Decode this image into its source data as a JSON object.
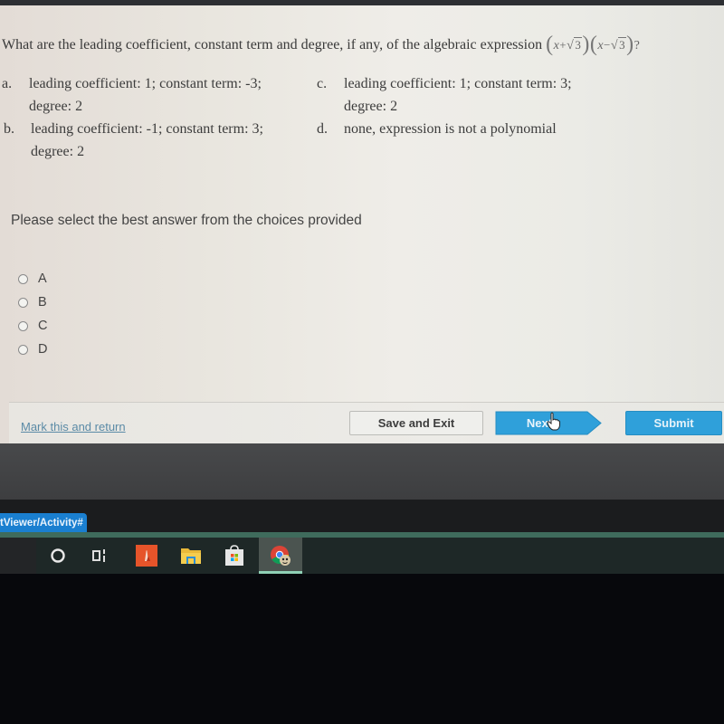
{
  "question": {
    "text": "What are the leading coefficient, constant term and degree, if any, of the algebraic expression",
    "expression": {
      "factor1": {
        "var": "x",
        "op": "+",
        "radicand": "3"
      },
      "factor2": {
        "var": "x",
        "op": "−",
        "radicand": "3"
      },
      "suffix": "?"
    }
  },
  "choices": [
    {
      "letter": "a.",
      "text": "leading coefficient: 1; constant term: -3; degree: 2"
    },
    {
      "letter": "b.",
      "text": "leading coefficient: -1; constant term: 3; degree: 2"
    },
    {
      "letter": "c.",
      "text": "leading coefficient: 1; constant term: 3; degree: 2"
    },
    {
      "letter": "d.",
      "text": "none, expression is not a polynomial"
    }
  ],
  "prompt": "Please select the best answer from the choices provided",
  "answer_options": [
    {
      "label": "A",
      "selected": false
    },
    {
      "label": "B",
      "selected": false
    },
    {
      "label": "C",
      "selected": false
    },
    {
      "label": "D",
      "selected": false
    }
  ],
  "footer": {
    "mark_link": "Mark this and return",
    "save_exit": "Save and Exit",
    "next": "Next",
    "submit": "Submit"
  },
  "browser": {
    "url_fragment": "tViewer/Activity#"
  },
  "taskbar": {
    "items": [
      {
        "name": "cortana",
        "icon": "circle-icon"
      },
      {
        "name": "task-view",
        "icon": "task-view-icon"
      },
      {
        "name": "app-orange",
        "icon": "orange-app-icon"
      },
      {
        "name": "file-explorer",
        "icon": "folder-icon"
      },
      {
        "name": "store",
        "icon": "store-bag-icon"
      },
      {
        "name": "chrome",
        "icon": "chrome-icon",
        "active": true
      }
    ]
  },
  "colors": {
    "accent_blue": "#2fa0da",
    "link": "#5a8aa6",
    "taskbar": "#1e2827",
    "url_tab": "#1a7fd0"
  }
}
